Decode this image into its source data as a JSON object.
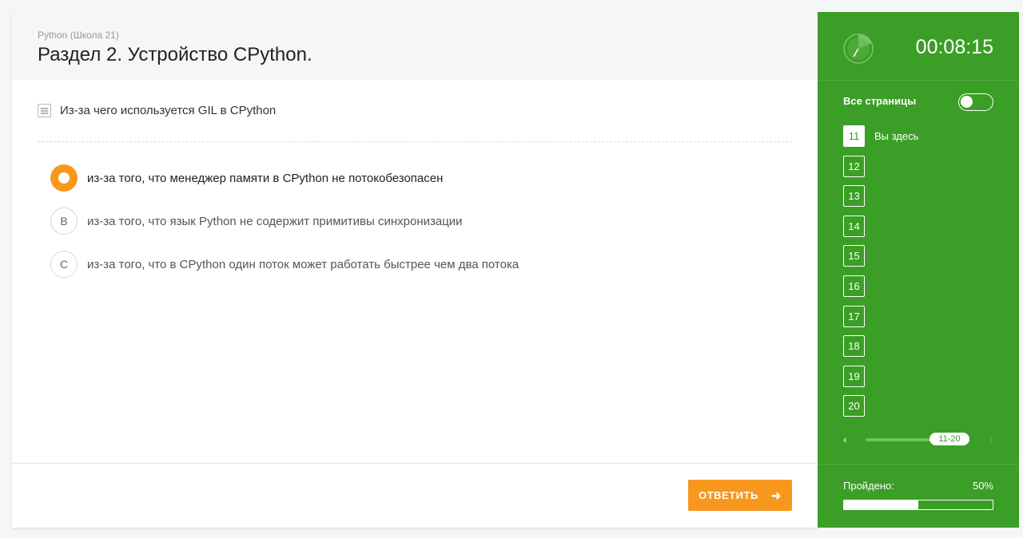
{
  "header": {
    "breadcrumb": "Python (Школа 21)",
    "title": "Раздел 2. Устройство CPython."
  },
  "question": {
    "icon": "list-icon",
    "text": "Из-за чего используется GIL в CPython"
  },
  "options": [
    {
      "marker": "",
      "text": "из-за того, что менеджер памяти в CPython не потокобезопасен",
      "selected": true
    },
    {
      "marker": "B",
      "text": "из-за того, что язык Python не содержит примитивы синхронизации",
      "selected": false
    },
    {
      "marker": "C",
      "text": "из-за того, что в CPython один поток может работать быстрее чем два потока",
      "selected": false
    }
  ],
  "footer": {
    "answer_label": "ОТВЕТИТЬ",
    "answer_icon": "arrow-right-icon"
  },
  "sidebar": {
    "timer": "00:08:15",
    "all_pages_label": "Все страницы",
    "all_pages_enabled": false,
    "pages": [
      {
        "num": "11",
        "current": true,
        "label": "Вы здесь"
      },
      {
        "num": "12",
        "current": false,
        "label": ""
      },
      {
        "num": "13",
        "current": false,
        "label": ""
      },
      {
        "num": "14",
        "current": false,
        "label": ""
      },
      {
        "num": "15",
        "current": false,
        "label": ""
      },
      {
        "num": "16",
        "current": false,
        "label": ""
      },
      {
        "num": "17",
        "current": false,
        "label": ""
      },
      {
        "num": "18",
        "current": false,
        "label": ""
      },
      {
        "num": "19",
        "current": false,
        "label": ""
      },
      {
        "num": "20",
        "current": false,
        "label": ""
      }
    ],
    "pager": {
      "range": "11-20",
      "prev": "‹",
      "next": "›"
    },
    "progress_label": "Пройдено:",
    "progress_value": "50%",
    "progress_fraction": 0.5
  },
  "colors": {
    "accent": "#f8971d",
    "sidebar": "#3b9e26"
  }
}
